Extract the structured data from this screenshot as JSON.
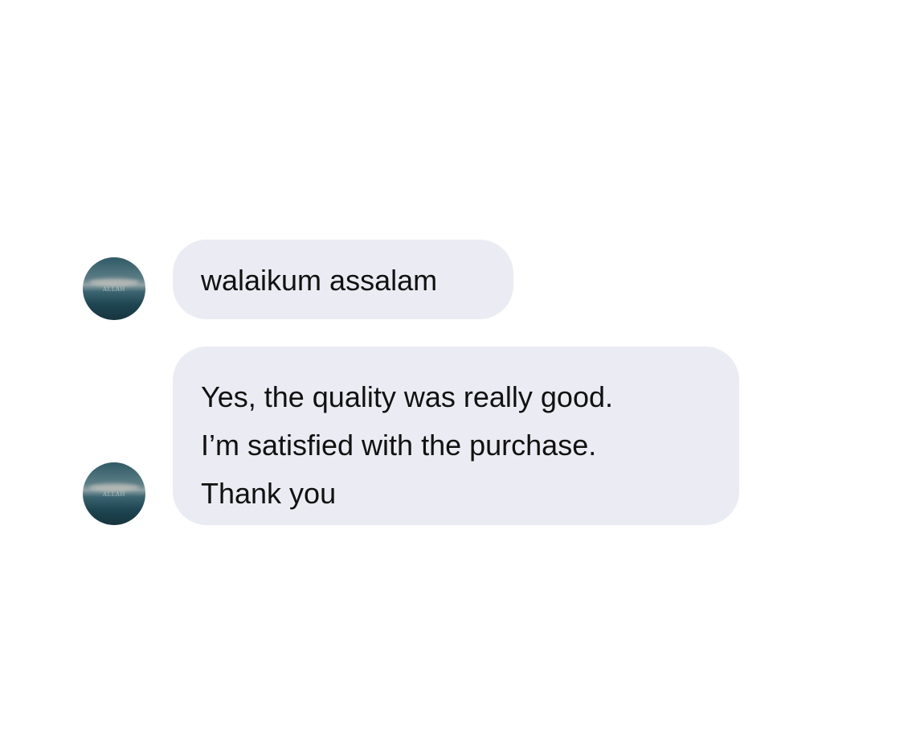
{
  "messages": [
    {
      "lines": [
        "walaikum assalam"
      ],
      "avatar": {
        "caption": "ALLAH"
      }
    },
    {
      "lines": [
        "Yes, the quality was really good.",
        "I’m satisfied with the purchase.",
        "Thank you"
      ],
      "avatar": {
        "caption": "ALLAH"
      }
    }
  ],
  "colors": {
    "bubble_background": "#ebebf3",
    "text": "#111111",
    "page_background": "#ffffff"
  }
}
